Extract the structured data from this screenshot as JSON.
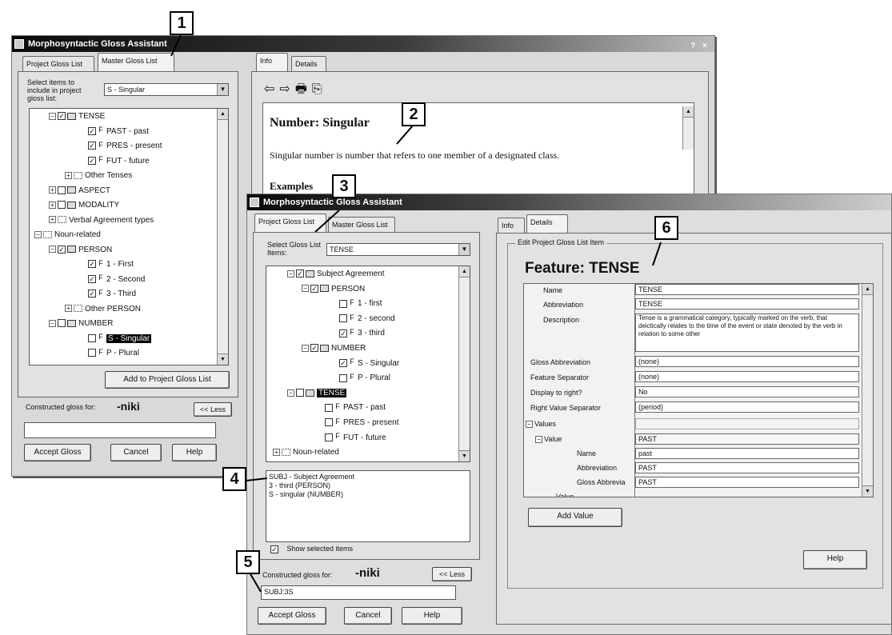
{
  "win1": {
    "title": "Morphosyntactic Gloss Assistant",
    "winbtns": "? ×",
    "tabs": {
      "project": "Project Gloss List",
      "master": "Master Gloss List"
    },
    "select_label": "Select items to include in project gloss list:",
    "select_value": "S - Singular",
    "tree": [
      {
        "expander": "−",
        "check": "✓",
        "icon": "folder",
        "label": "TENSE"
      },
      {
        "expander": "",
        "check": "✓",
        "icon": "feature",
        "label": "PAST - past"
      },
      {
        "expander": "",
        "check": "✓",
        "icon": "feature",
        "label": "PRES - present"
      },
      {
        "expander": "",
        "check": "✓",
        "icon": "feature",
        "label": "FUT - future"
      },
      {
        "expander": "+",
        "check": "",
        "icon": "folder-open",
        "label": "Other Tenses"
      },
      {
        "expander": "+",
        "check": "",
        "icon": "folder",
        "label": "ASPECT"
      },
      {
        "expander": "+",
        "check": "",
        "icon": "folder",
        "label": "MODALITY"
      },
      {
        "expander": "+",
        "check": "",
        "icon": "folder-open",
        "label": "Verbal Agreement types"
      },
      {
        "expander": "−",
        "check": "",
        "icon": "folder-open",
        "label": "Noun-related"
      },
      {
        "expander": "−",
        "check": "✓",
        "icon": "folder",
        "label": "PERSON"
      },
      {
        "expander": "",
        "check": "✓",
        "icon": "feature",
        "label": "1 - First"
      },
      {
        "expander": "",
        "check": "✓",
        "icon": "feature",
        "label": "2 - Second"
      },
      {
        "expander": "",
        "check": "✓",
        "icon": "feature",
        "label": "3 - Third"
      },
      {
        "expander": "+",
        "check": "",
        "icon": "folder-open",
        "label": "Other PERSON"
      },
      {
        "expander": "−",
        "check": "",
        "icon": "folder",
        "label": "NUMBER"
      },
      {
        "expander": "",
        "check": "",
        "icon": "feature",
        "label": "S - Singular"
      },
      {
        "expander": "",
        "check": "",
        "icon": "feature",
        "label": "P - Plural"
      }
    ],
    "add_button": "Add to Project Gloss List",
    "constructed_label": "Constructed gloss for:",
    "constructed_word": "-niki",
    "less_button": "<< Less",
    "accept": "Accept Gloss",
    "cancel": "Cancel",
    "help": "Help"
  },
  "win2": {
    "tabs": {
      "info": "Info",
      "details": "Details"
    },
    "heading": "Number: Singular",
    "body": "Singular number is number that refers to one member of a designated class.",
    "example_label": "Examples"
  },
  "win3": {
    "title": "Morphosyntactic Gloss Assistant",
    "tabs": {
      "project": "Project Gloss List",
      "master": "Master Gloss List"
    },
    "select_label": "Select Gloss List Items:",
    "select_value": "TENSE",
    "tree": [
      {
        "expander": "−",
        "check": "✓",
        "icon": "folder",
        "label": "Subject Agreement"
      },
      {
        "expander": "−",
        "check": "✓",
        "icon": "folder",
        "label": "PERSON"
      },
      {
        "expander": "",
        "check": "",
        "icon": "feature",
        "label": "1 - first"
      },
      {
        "expander": "",
        "check": "",
        "icon": "feature",
        "label": "2 - second"
      },
      {
        "expander": "",
        "check": "✓",
        "icon": "feature",
        "label": "3 - third"
      },
      {
        "expander": "−",
        "check": "✓",
        "icon": "folder",
        "label": "NUMBER"
      },
      {
        "expander": "",
        "check": "✓",
        "icon": "feature",
        "label": "S - Singular"
      },
      {
        "expander": "",
        "check": "",
        "icon": "feature",
        "label": "P - Plural"
      },
      {
        "expander": "−",
        "check": "",
        "icon": "folder",
        "label": "TENSE"
      },
      {
        "expander": "",
        "check": "",
        "icon": "feature",
        "label": "PAST - past"
      },
      {
        "expander": "",
        "check": "",
        "icon": "feature",
        "label": "PRES - present"
      },
      {
        "expander": "",
        "check": "",
        "icon": "feature",
        "label": "FUT - future"
      },
      {
        "expander": "+",
        "check": "",
        "icon": "folder-open",
        "label": "Noun-related"
      }
    ],
    "selected_items": [
      "SUBJ - Subject Agreement",
      "3 - third (PERSON)",
      "S - singular (NUMBER)"
    ],
    "show_selected": "Show selected items",
    "constructed_label": "Constructed gloss for:",
    "constructed_word": "-niki",
    "less_button": "<< Less",
    "gloss_value": "SUBJ:3S",
    "accept": "Accept Gloss",
    "cancel": "Cancel",
    "help": "Help",
    "right_tabs": {
      "info": "Info",
      "details": "Details"
    },
    "group_label": "Edit Project Gloss List Item",
    "feature_heading": "Feature: TENSE",
    "props": [
      {
        "label": "Name",
        "value": "TENSE"
      },
      {
        "label": "Abbreviation",
        "value": "TENSE"
      },
      {
        "label": "Description",
        "value": "Tense is a grammatical category, typically marked on the verb, that deictically relates to the time of the event or state denoted by the verb in relation to some other"
      },
      {
        "label": "Gloss Abbreviation",
        "value": "(none)"
      },
      {
        "label": "Feature Separator",
        "value": "(none)"
      },
      {
        "label": "Display to right?",
        "value": "No"
      },
      {
        "label": "Right Value Separator",
        "value": "(period)"
      }
    ],
    "values_label": "Values",
    "value_label": "Value",
    "value_value": "PAST",
    "sub_props": [
      {
        "label": "Name",
        "value": "past"
      },
      {
        "label": "Abbreviation",
        "value": "PAST"
      },
      {
        "label": "Gloss Abbrevia",
        "value": "PAST"
      }
    ],
    "more_value": "Value",
    "add_value": "Add Value",
    "help_right": "Help"
  },
  "callouts": [
    "1",
    "2",
    "3",
    "4",
    "5",
    "6"
  ]
}
